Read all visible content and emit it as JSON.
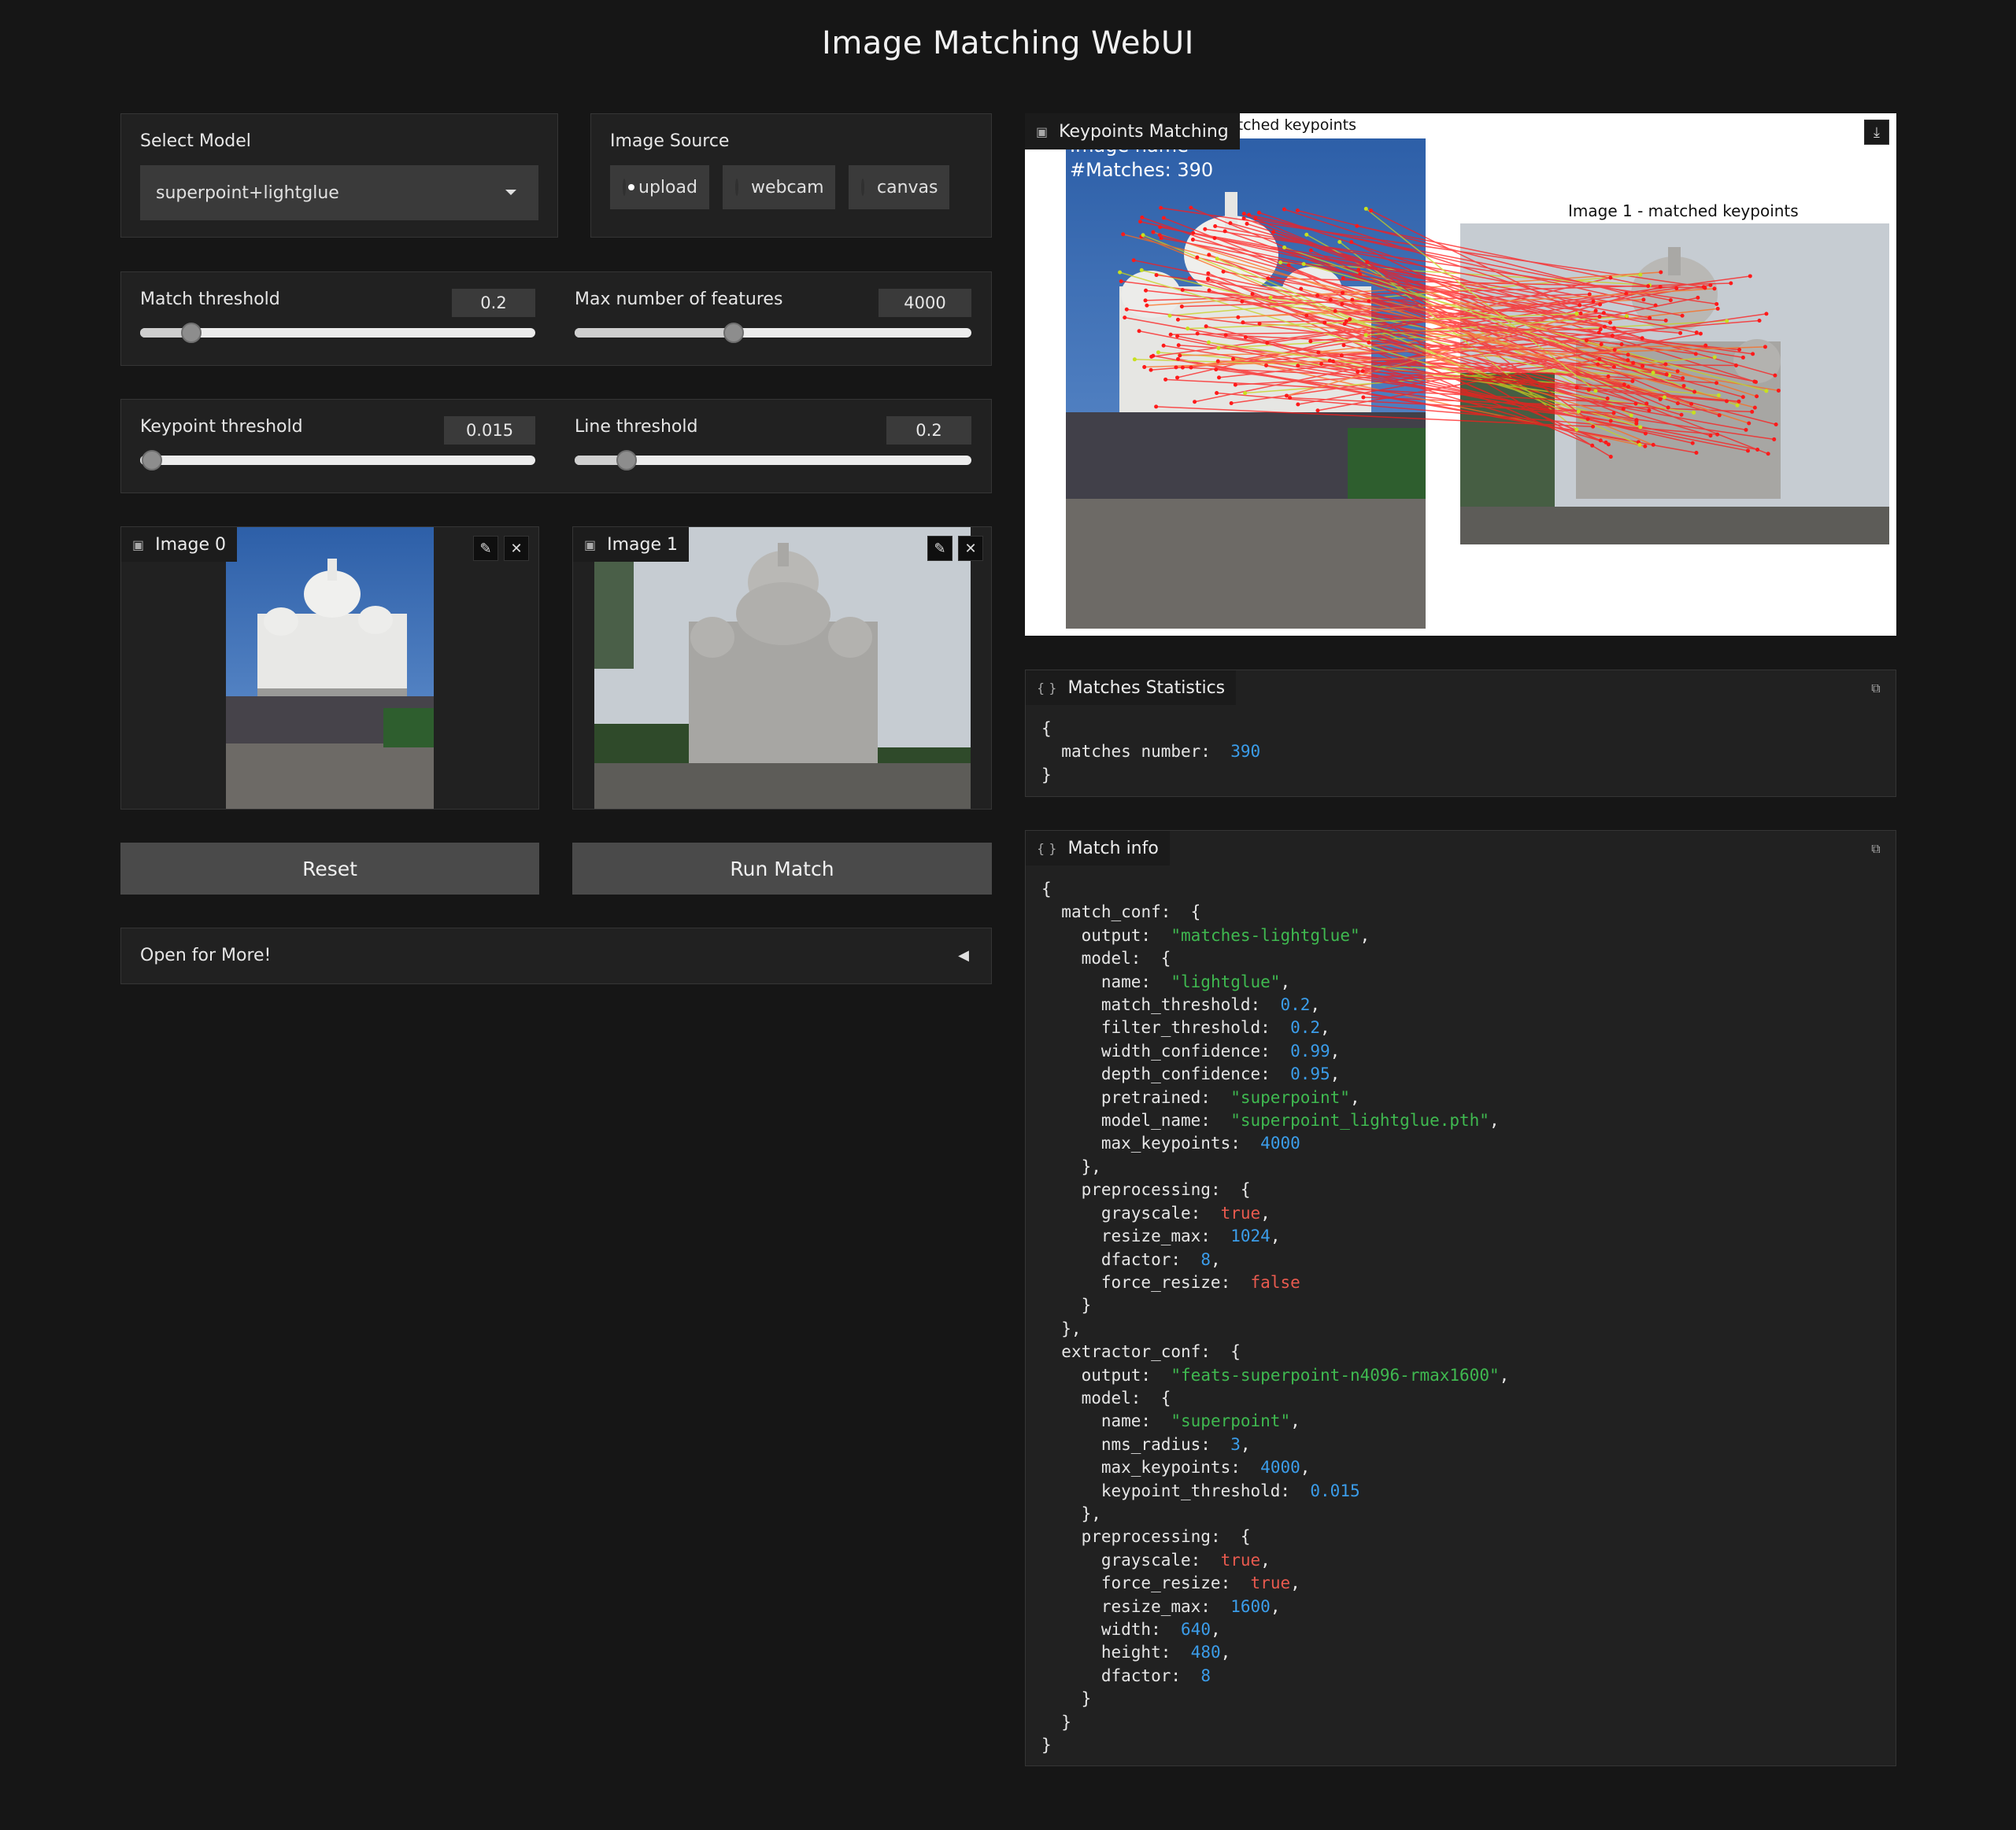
{
  "title": "Image Matching WebUI",
  "model_select": {
    "label": "Select Model",
    "value": "superpoint+lightglue"
  },
  "image_source": {
    "label": "Image Source",
    "options": [
      "upload",
      "webcam",
      "canvas"
    ],
    "selected": "upload"
  },
  "sliders": {
    "match_threshold": {
      "label": "Match threshold",
      "value": "0.2",
      "fraction": 0.13
    },
    "max_features": {
      "label": "Max number of features",
      "value": "4000",
      "fraction": 0.4
    },
    "keypoint_threshold": {
      "label": "Keypoint threshold",
      "value": "0.015",
      "fraction": 0.03
    },
    "line_threshold": {
      "label": "Line threshold",
      "value": "0.2",
      "fraction": 0.13
    }
  },
  "image0": {
    "label": "Image 0"
  },
  "image1": {
    "label": "Image 1"
  },
  "buttons": {
    "reset": "Reset",
    "run": "Run Match"
  },
  "accordion": {
    "label": "Open for More!"
  },
  "keypoints_panel": {
    "label": "Keypoints Matching",
    "left_title_partial": "atched keypoints",
    "right_title": "Image 1 - matched keypoints",
    "overlay_name": "Image name",
    "overlay_matches": "#Matches: 390"
  },
  "stats_panel": {
    "label": "Matches Statistics"
  },
  "info_panel": {
    "label": "Match info"
  },
  "icons": [
    "image-icon",
    "edit-icon",
    "close-icon",
    "download-icon",
    "copy-icon",
    "json-icon",
    "chevron-left-icon",
    "dropdown-caret-icon"
  ]
}
